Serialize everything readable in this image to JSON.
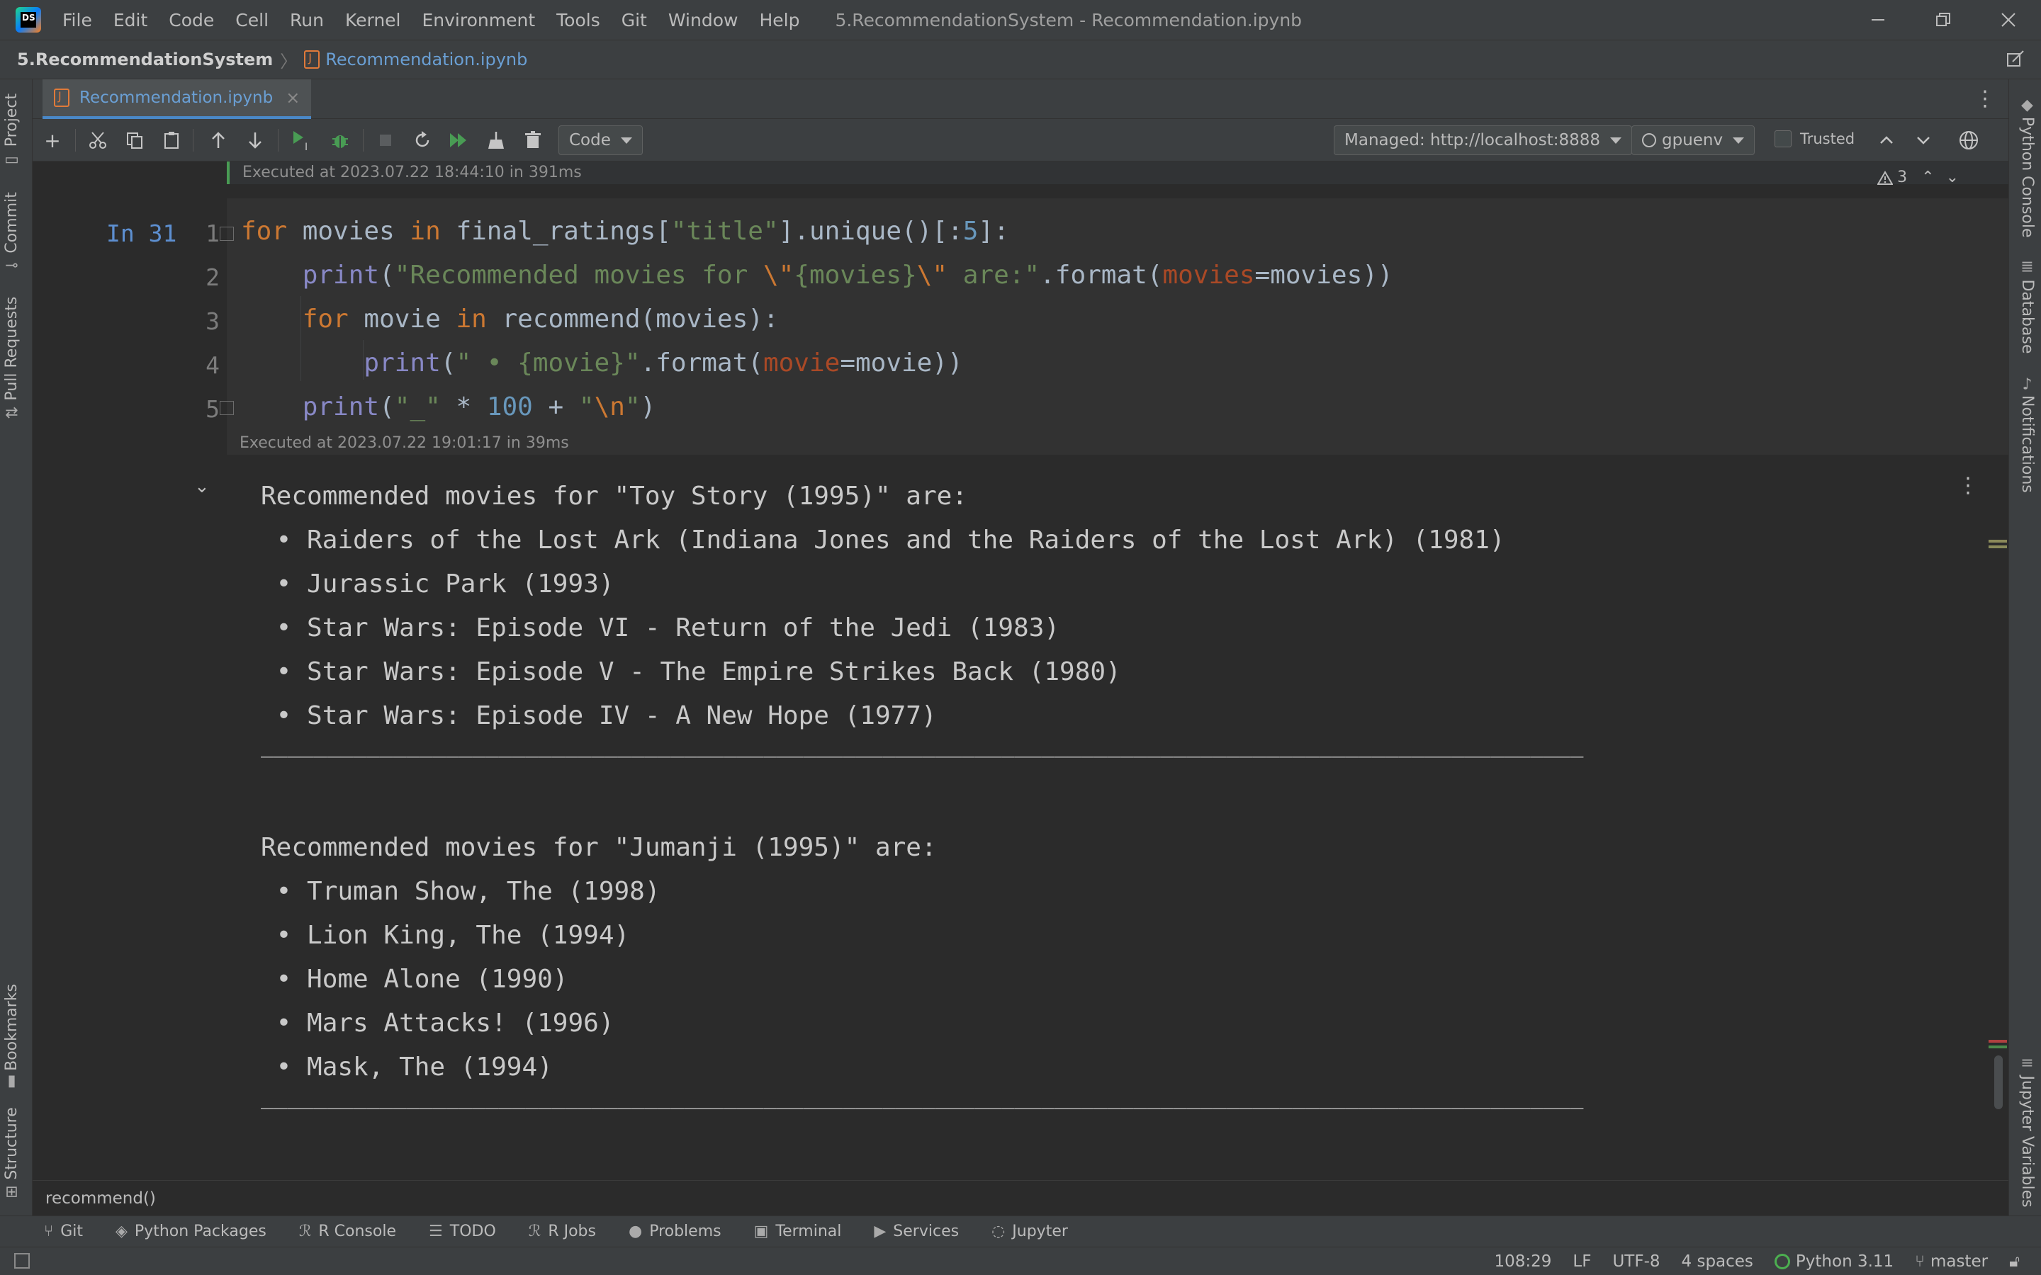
{
  "titlebar": {
    "logo_text": "DS",
    "menu": [
      "File",
      "Edit",
      "Code",
      "Cell",
      "Run",
      "Kernel",
      "Environment",
      "Tools",
      "Git",
      "Window",
      "Help"
    ],
    "window_title": "5.RecommendationSystem - Recommendation.ipynb"
  },
  "navbar": {
    "project": "5.RecommendationSystem",
    "file": "Recommendation.ipynb"
  },
  "left_tools": [
    "Project",
    "Commit",
    "Pull Requests",
    "Bookmarks",
    "Structure"
  ],
  "right_tools": [
    "Python Console",
    "Database",
    "Notifications",
    "Jupyter Variables"
  ],
  "editor_tab": {
    "label": "Recommendation.ipynb"
  },
  "toolbar": {
    "cell_type": "Code",
    "server": "Managed: http://localhost:8888",
    "kernel": "gpuenv",
    "trusted_label": "Trusted"
  },
  "cell": {
    "prev_exec": "Executed at 2023.07.22 18:44:10 in 391ms",
    "prompt": "In 31",
    "line_numbers": [
      "1",
      "2",
      "3",
      "4",
      "5"
    ],
    "exec": "Executed at 2023.07.22 19:01:17 in 39ms",
    "warnings": "3"
  },
  "output": {
    "lines": [
      "Recommended movies for \"Toy Story (1995)\" are:",
      " • Raiders of the Lost Ark (Indiana Jones and the Raiders of the Lost Ark) (1981)",
      " • Jurassic Park (1993)",
      " • Star Wars: Episode VI - Return of the Jedi (1983)",
      " • Star Wars: Episode V - The Empire Strikes Back (1980)",
      " • Star Wars: Episode IV - A New Hope (1977)",
      "____________________________________________________________________________________________________",
      "",
      "Recommended movies for \"Jumanji (1995)\" are:",
      " • Truman Show, The (1998)",
      " • Lion King, The (1994)",
      " • Home Alone (1990)",
      " • Mars Attacks! (1996)",
      " • Mask, The (1994)",
      "____________________________________________________________________________________________________"
    ]
  },
  "editor_footer": "recommend()",
  "bottom_tools": [
    "Git",
    "Python Packages",
    "R Console",
    "TODO",
    "R Jobs",
    "Problems",
    "Terminal",
    "Services",
    "Jupyter"
  ],
  "status": {
    "position": "108:29",
    "line_sep": "LF",
    "encoding": "UTF-8",
    "indent": "4 spaces",
    "interpreter": "Python 3.11",
    "branch": "master"
  },
  "colors": {
    "keyword": "#cc7832",
    "string": "#6a8759",
    "number": "#6897bb",
    "param": "#aa4926",
    "prompt": "#5d8fd0",
    "link": "#6a9fd4"
  }
}
